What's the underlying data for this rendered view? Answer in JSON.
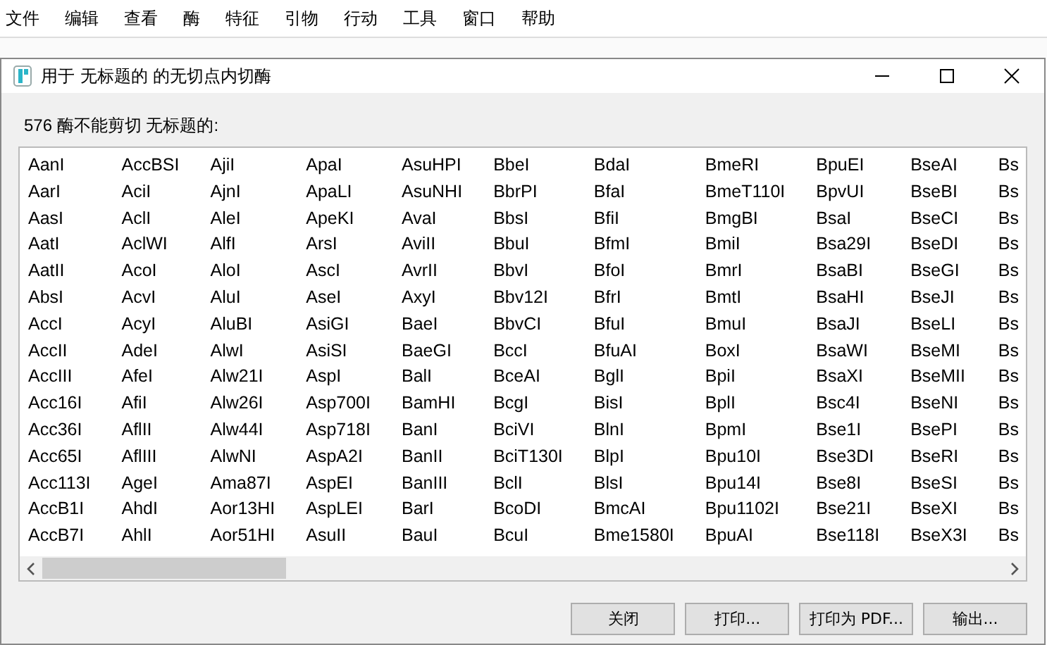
{
  "menu": [
    "文件",
    "编辑",
    "查看",
    "酶",
    "特征",
    "引物",
    "行动",
    "工具",
    "窗口",
    "帮助"
  ],
  "dialog": {
    "title": "用于 无标题的 的无切点内切酶",
    "summary": "576 酶不能剪切 无标题的:",
    "columns": [
      [
        "AanI",
        "AarI",
        "AasI",
        "AatI",
        "AatII",
        "AbsI",
        "AccI",
        "AccII",
        "AccIII",
        "Acc16I",
        "Acc36I",
        "Acc65I",
        "Acc113I",
        "AccB1I",
        "AccB7I"
      ],
      [
        "AccBSI",
        "AciI",
        "AclI",
        "AclWI",
        "AcoI",
        "AcvI",
        "AcyI",
        "AdeI",
        "AfeI",
        "AfiI",
        "AflII",
        "AflIII",
        "AgeI",
        "AhdI",
        "AhlI"
      ],
      [
        "AjiI",
        "AjnI",
        "AleI",
        "AlfI",
        "AloI",
        "AluI",
        "AluBI",
        "AlwI",
        "Alw21I",
        "Alw26I",
        "Alw44I",
        "AlwNI",
        "Ama87I",
        "Aor13HI",
        "Aor51HI"
      ],
      [
        "ApaI",
        "ApaLI",
        "ApeKI",
        "ArsI",
        "AscI",
        "AseI",
        "AsiGI",
        "AsiSI",
        "AspI",
        "Asp700I",
        "Asp718I",
        "AspA2I",
        "AspEI",
        "AspLEI",
        "AsuII"
      ],
      [
        "AsuHPI",
        "AsuNHI",
        "AvaI",
        "AviII",
        "AvrII",
        "AxyI",
        "BaeI",
        "BaeGI",
        "BalI",
        "BamHI",
        "BanI",
        "BanII",
        "BanIII",
        "BarI",
        "BauI"
      ],
      [
        "BbeI",
        "BbrPI",
        "BbsI",
        "BbuI",
        "BbvI",
        "Bbv12I",
        "BbvCI",
        "BccI",
        "BceAI",
        "BcgI",
        "BciVI",
        "BciT130I",
        "BclI",
        "BcoDI",
        "BcuI"
      ],
      [
        "BdaI",
        "BfaI",
        "BfiI",
        "BfmI",
        "BfoI",
        "BfrI",
        "BfuI",
        "BfuAI",
        "BglI",
        "BisI",
        "BlnI",
        "BlpI",
        "BlsI",
        "BmcAI",
        "Bme1580I"
      ],
      [
        "BmeRI",
        "BmeT110I",
        "BmgBI",
        "BmiI",
        "BmrI",
        "BmtI",
        "BmuI",
        "BoxI",
        "BpiI",
        "BplI",
        "BpmI",
        "Bpu10I",
        "Bpu14I",
        "Bpu1102I",
        "BpuAI"
      ],
      [
        "BpuEI",
        "BpvUI",
        "BsaI",
        "Bsa29I",
        "BsaBI",
        "BsaHI",
        "BsaJI",
        "BsaWI",
        "BsaXI",
        "Bsc4I",
        "Bse1I",
        "Bse3DI",
        "Bse8I",
        "Bse21I",
        "Bse118I"
      ],
      [
        "BseAI",
        "BseBI",
        "BseCI",
        "BseDI",
        "BseGI",
        "BseJI",
        "BseLI",
        "BseMI",
        "BseMII",
        "BseNI",
        "BsePI",
        "BseRI",
        "BseSI",
        "BseXI",
        "BseX3I"
      ],
      [
        "Bs",
        "Bs",
        "Bs",
        "Bs",
        "Bs",
        "Bs",
        "Bs",
        "Bs",
        "Bs",
        "Bs",
        "Bs",
        "Bs",
        "Bs",
        "Bs",
        "Bs"
      ]
    ],
    "buttons": [
      "关闭",
      "打印...",
      "打印为 PDF...",
      "输出..."
    ]
  }
}
